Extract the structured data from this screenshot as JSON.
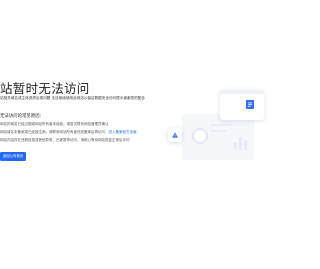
{
  "error": {
    "title": "站暂时无法访问",
    "description": "站相关域名或主体资质出现问题 无法继续使用此网站以保证数据安全访问提示谢谢您的配合",
    "reasons_title": "无法访问的常见原因：",
    "reasons": [
      {
        "text": "网站的域名已经过期或网站所有者未续费，请尝试联系网站管理员确认"
      },
      {
        "text": "网站域名未备案或已经被注销，请联系网站所有者完成备案后再访问，",
        "link": "进入备案官方页面"
      },
      {
        "text": "网站内容存在违规信息或其他异常，已被暂停访问，请耐心等待网站恢复正常后访问"
      }
    ],
    "button_label": "返回公司首页"
  },
  "colors": {
    "accent": "#2468f2",
    "title": "#1f1f1f"
  },
  "illustration": {
    "icons": [
      "document-icon",
      "warning-icon"
    ]
  }
}
